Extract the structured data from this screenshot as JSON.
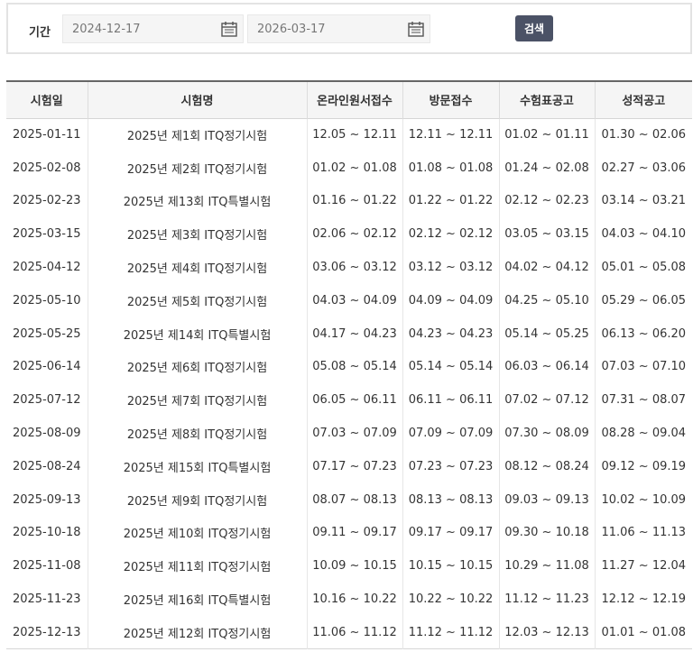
{
  "filter": {
    "label": "기간",
    "start_date": "2024-12-17",
    "end_date": "2026-03-17",
    "search_label": "검색"
  },
  "table": {
    "headers": [
      "시험일",
      "시험명",
      "온라인원서접수",
      "방문접수",
      "수험표공고",
      "성적공고"
    ],
    "rows": [
      [
        "2025-01-11",
        "2025년 제1회 ITQ정기시험",
        "12.05 ~ 12.11",
        "12.11 ~ 12.11",
        "01.02 ~ 01.11",
        "01.30 ~ 02.06"
      ],
      [
        "2025-02-08",
        "2025년 제2회 ITQ정기시험",
        "01.02 ~ 01.08",
        "01.08 ~ 01.08",
        "01.24 ~ 02.08",
        "02.27 ~ 03.06"
      ],
      [
        "2025-02-23",
        "2025년 제13회 ITQ특별시험",
        "01.16 ~ 01.22",
        "01.22 ~ 01.22",
        "02.12 ~ 02.23",
        "03.14 ~ 03.21"
      ],
      [
        "2025-03-15",
        "2025년 제3회 ITQ정기시험",
        "02.06 ~ 02.12",
        "02.12 ~ 02.12",
        "03.05 ~ 03.15",
        "04.03 ~ 04.10"
      ],
      [
        "2025-04-12",
        "2025년 제4회 ITQ정기시험",
        "03.06 ~ 03.12",
        "03.12 ~ 03.12",
        "04.02 ~ 04.12",
        "05.01 ~ 05.08"
      ],
      [
        "2025-05-10",
        "2025년 제5회 ITQ정기시험",
        "04.03 ~ 04.09",
        "04.09 ~ 04.09",
        "04.25 ~ 05.10",
        "05.29 ~ 06.05"
      ],
      [
        "2025-05-25",
        "2025년 제14회 ITQ특별시험",
        "04.17 ~ 04.23",
        "04.23 ~ 04.23",
        "05.14 ~ 05.25",
        "06.13 ~ 06.20"
      ],
      [
        "2025-06-14",
        "2025년 제6회 ITQ정기시험",
        "05.08 ~ 05.14",
        "05.14 ~ 05.14",
        "06.03 ~ 06.14",
        "07.03 ~ 07.10"
      ],
      [
        "2025-07-12",
        "2025년 제7회 ITQ정기시험",
        "06.05 ~ 06.11",
        "06.11 ~ 06.11",
        "07.02 ~ 07.12",
        "07.31 ~ 08.07"
      ],
      [
        "2025-08-09",
        "2025년 제8회 ITQ정기시험",
        "07.03 ~ 07.09",
        "07.09 ~ 07.09",
        "07.30 ~ 08.09",
        "08.28 ~ 09.04"
      ],
      [
        "2025-08-24",
        "2025년 제15회 ITQ특별시험",
        "07.17 ~ 07.23",
        "07.23 ~ 07.23",
        "08.12 ~ 08.24",
        "09.12 ~ 09.19"
      ],
      [
        "2025-09-13",
        "2025년 제9회 ITQ정기시험",
        "08.07 ~ 08.13",
        "08.13 ~ 08.13",
        "09.03 ~ 09.13",
        "10.02 ~ 10.09"
      ],
      [
        "2025-10-18",
        "2025년 제10회 ITQ정기시험",
        "09.11 ~ 09.17",
        "09.17 ~ 09.17",
        "09.30 ~ 10.18",
        "11.06 ~ 11.13"
      ],
      [
        "2025-11-08",
        "2025년 제11회 ITQ정기시험",
        "10.09 ~ 10.15",
        "10.15 ~ 10.15",
        "10.29 ~ 11.08",
        "11.27 ~ 12.04"
      ],
      [
        "2025-11-23",
        "2025년 제16회 ITQ특별시험",
        "10.16 ~ 10.22",
        "10.22 ~ 10.22",
        "11.12 ~ 11.23",
        "12.12 ~ 12.19"
      ],
      [
        "2025-12-13",
        "2025년 제12회 ITQ정기시험",
        "11.06 ~ 11.12",
        "11.12 ~ 11.12",
        "12.03 ~ 12.13",
        "01.01 ~ 01.08"
      ]
    ]
  }
}
